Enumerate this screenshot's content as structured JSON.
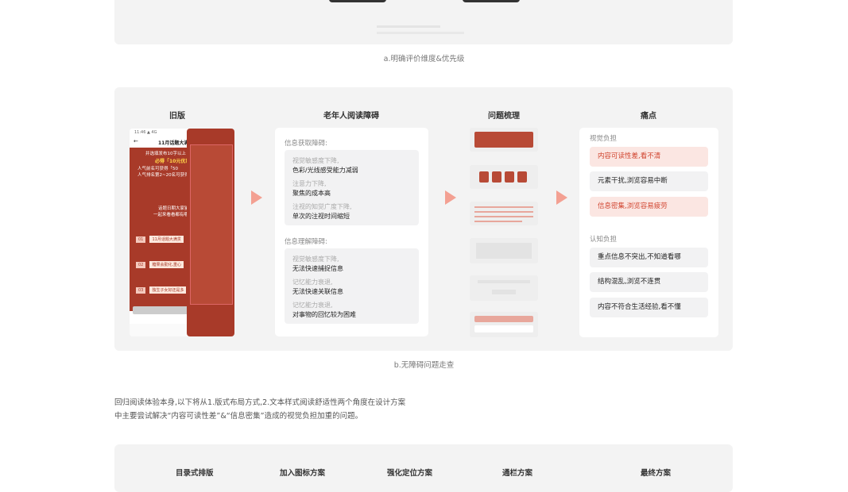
{
  "caption_a": "a.明确评价维度&优先级",
  "caption_b": "b.无障碍问题走查",
  "columns": {
    "old": "旧版",
    "barriers": "老年人阅读障碍",
    "sorting": "问题梳理",
    "pain": "痛点"
  },
  "barriers": {
    "section1": "信息获取障碍:",
    "group1": [
      {
        "sub": "视觉敏感度下降,",
        "main": "色彩/光线感受能力减弱"
      },
      {
        "sub": "注意力下降,",
        "main": "聚焦的成本高"
      },
      {
        "sub": "注视的知觉广度下降,",
        "main": "单次的注视时间缩短"
      }
    ],
    "section2": "信息理解障碍:",
    "group2": [
      {
        "sub": "视觉敏感度下降,",
        "main": "无法快速捕捉信息"
      },
      {
        "sub": "记忆能力衰退,",
        "main": "无法快速关联信息"
      },
      {
        "sub": "记忆能力衰退,",
        "main": "对事物的回忆较为困难"
      }
    ]
  },
  "pain": {
    "section1": "视觉负担",
    "items1": [
      "内容可读性差,看不清",
      "元素干扰,浏览容易中断",
      "信息密集,浏览容易疲劳"
    ],
    "section2": "认知负担",
    "items2": [
      "重点信息不突出,不知道看哪",
      "结构混乱,浏览不连贯",
      "内容不符合生活经验,看不懂"
    ]
  },
  "old_phone": {
    "title": "11月话题大满贯",
    "line1": "并选填发布10字以上",
    "line2": "必得「10元优惠",
    "line3": "人气前名可获得「50",
    "line4": "人气排名第2~20名可获得",
    "line5": "话题日期大家鉴",
    "line6": "一起来看看都有哪",
    "items": [
      {
        "num": "01",
        "label": "11月话题大满贯"
      },
      {
        "num": "02",
        "label": "糖果会勤化,重心"
      },
      {
        "num": "03",
        "label": "独生子女好还是多"
      }
    ]
  },
  "body_text": {
    "line1": "回归阅读体验本身,以下将从1.版式布局方式,2.文本样式阅读舒适性两个角度在设计方案",
    "line2": "中主要尝试解决“内容可读性差”&“信息密集”造成的视觉负担加重的问题。"
  },
  "bottom_headers": [
    "目录式排版",
    "加入图标方案",
    "强化定位方案",
    "通栏方案",
    "最终方案"
  ],
  "colors": {
    "accent": "#e8503a",
    "highlight_bg": "#fbe6e2",
    "panel_bg": "#f3f3f3",
    "phone_red": "#a83a29"
  }
}
